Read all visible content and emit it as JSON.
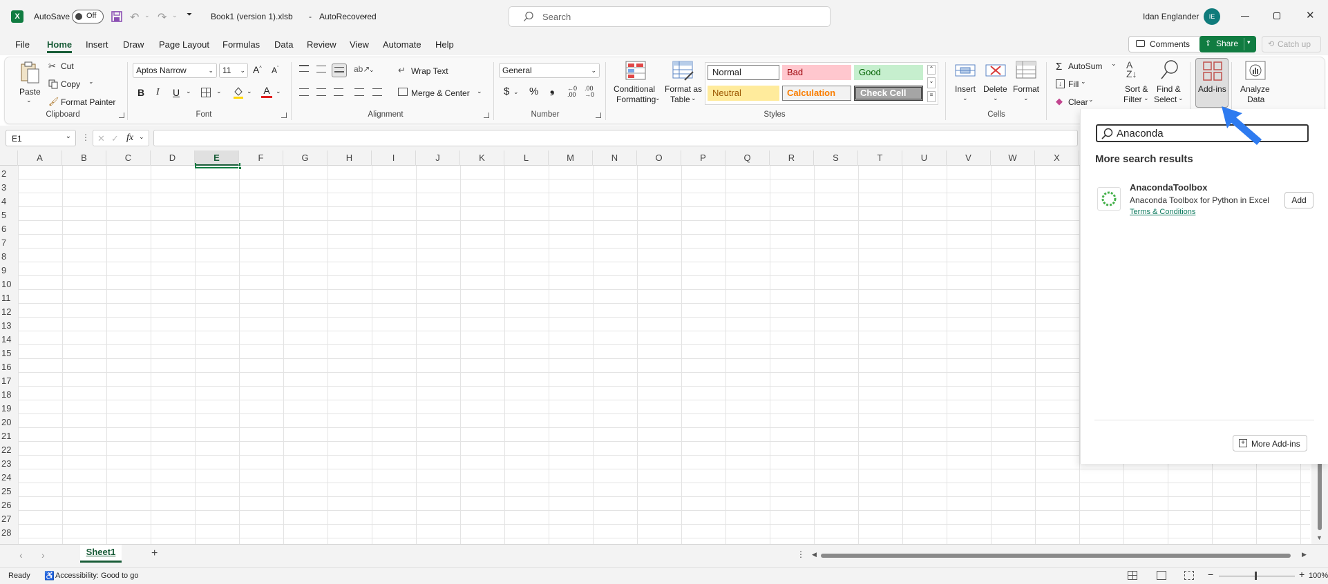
{
  "titlebar": {
    "autosave_label": "AutoSave",
    "autosave_state": "Off",
    "filename": "Book1 (version 1).xlsb",
    "separator": "-",
    "status": "AutoRecovered",
    "search_placeholder": "Search",
    "user_name": "Idan Englander",
    "user_initials": "IE"
  },
  "menu": {
    "tabs": [
      "File",
      "Home",
      "Insert",
      "Draw",
      "Page Layout",
      "Formulas",
      "Data",
      "Review",
      "View",
      "Automate",
      "Help"
    ],
    "comments": "Comments",
    "share": "Share",
    "catch_up": "Catch up"
  },
  "ribbon": {
    "clipboard": {
      "paste": "Paste",
      "cut": "Cut",
      "copy": "Copy",
      "format_painter": "Format Painter",
      "label": "Clipboard"
    },
    "font": {
      "name": "Aptos Narrow",
      "size": "11",
      "label": "Font"
    },
    "alignment": {
      "wrap_text": "Wrap Text",
      "merge_center": "Merge & Center",
      "label": "Alignment"
    },
    "number": {
      "format": "General",
      "label": "Number"
    },
    "styles": {
      "conditional_1": "Conditional",
      "conditional_2": "Formatting",
      "format_table_1": "Format as",
      "format_table_2": "Table",
      "normal": "Normal",
      "bad": "Bad",
      "good": "Good",
      "neutral": "Neutral",
      "calculation": "Calculation",
      "check_cell": "Check Cell",
      "label": "Styles"
    },
    "cells": {
      "insert": "Insert",
      "delete": "Delete",
      "format": "Format",
      "label": "Cells"
    },
    "editing": {
      "autosum": "AutoSum",
      "fill": "Fill",
      "clear": "Clear",
      "sort_1": "Sort &",
      "sort_2": "Filter",
      "find_1": "Find &",
      "find_2": "Select"
    },
    "addins": {
      "label": "Add-ins"
    },
    "analyze": {
      "line1": "Analyze",
      "line2": "Data"
    }
  },
  "formula_bar": {
    "name_box": "E1",
    "fx": "fx",
    "content": ""
  },
  "columns": [
    "A",
    "B",
    "C",
    "D",
    "E",
    "F",
    "G",
    "H",
    "I",
    "J",
    "K",
    "L",
    "M",
    "N",
    "O",
    "P",
    "Q",
    "R",
    "S",
    "T",
    "U",
    "V",
    "W",
    "X"
  ],
  "rows": [
    "2",
    "3",
    "4",
    "5",
    "6",
    "7",
    "8",
    "9",
    "10",
    "11",
    "12",
    "13",
    "14",
    "15",
    "16",
    "17",
    "18",
    "19",
    "20",
    "21",
    "22",
    "23",
    "24",
    "25",
    "26",
    "27",
    "28"
  ],
  "panel": {
    "search_value": "Anaconda",
    "heading": "More search results",
    "result_title": "AnacondaToolbox",
    "result_desc": "Anaconda Toolbox for Python in Excel",
    "result_link": "Terms & Conditions",
    "add_button": "Add",
    "more_addins": "More Add-ins"
  },
  "sheets": {
    "tabs": [
      "Sheet1"
    ]
  },
  "status": {
    "ready": "Ready",
    "accessibility": "Accessibility: Good to go",
    "zoom": "100%"
  },
  "colors": {
    "accent": "#185c37",
    "arrow": "#2e7bf0",
    "bad_bg": "#ffc7ce",
    "good_bg": "#c6efce",
    "neutral_bg": "#ffeb9c"
  }
}
